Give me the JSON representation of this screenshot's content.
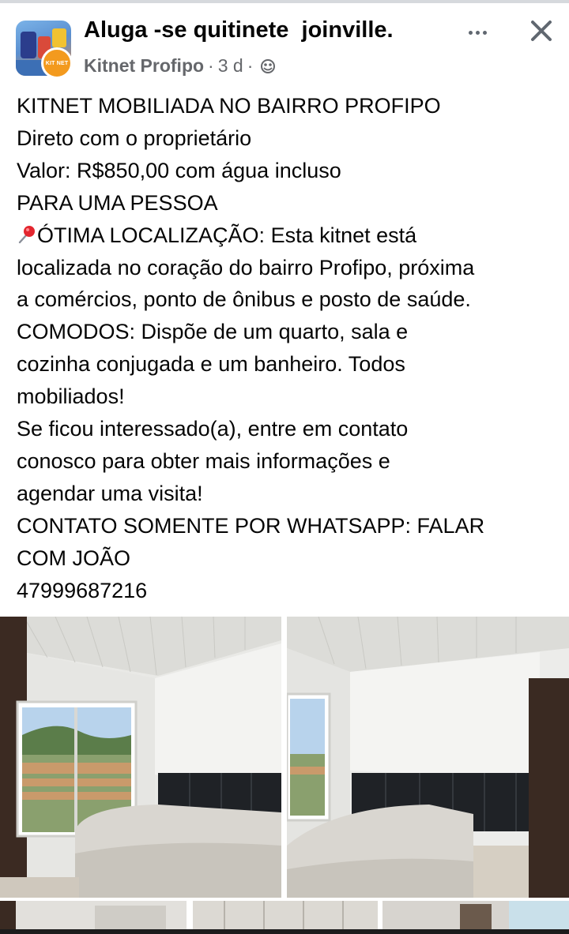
{
  "post": {
    "group_title": "Aluga -se quitinete  joinville.",
    "author": "Kitnet Profipo",
    "separator1": "·",
    "time": "3 d",
    "separator2": "·",
    "badge_text": "KIT NET",
    "privacy_icon": "globe-icon",
    "more_icon": "more-options-icon",
    "close_icon": "close-icon"
  },
  "body": {
    "lines": [
      "KITNET MOBILIADA NO BAIRRO PROFIPO",
      "Direto com o proprietário",
      "Valor: R$850,00 com água incluso",
      "PARA UMA PESSOA",
      "ÓTIMA LOCALIZAÇÃO: Esta kitnet está",
      "localizada no coração do bairro Profipo, próxima",
      "a comércios, ponto de ônibus e posto de saúde.",
      "COMODOS: Dispõe de um quarto, sala e",
      "cozinha conjugada e um banheiro. Todos",
      "mobiliados!",
      "Se ficou interessado(a), entre em contato",
      "conosco para obter mais informações e",
      "agendar uma visita!",
      "CONTATO SOMENTE POR WHATSAPP: FALAR",
      "COM JOÃO",
      "47999687216"
    ],
    "pin_icon": "round-pushpin-icon"
  },
  "photos": {
    "items": [
      "bedroom-photo-1",
      "bedroom-photo-2",
      "photo-thumbnail-3",
      "photo-thumbnail-4",
      "photo-thumbnail-5"
    ]
  },
  "colors": {
    "text": "#050505",
    "secondary_text": "#65676b",
    "badge": "#f39a1e"
  }
}
